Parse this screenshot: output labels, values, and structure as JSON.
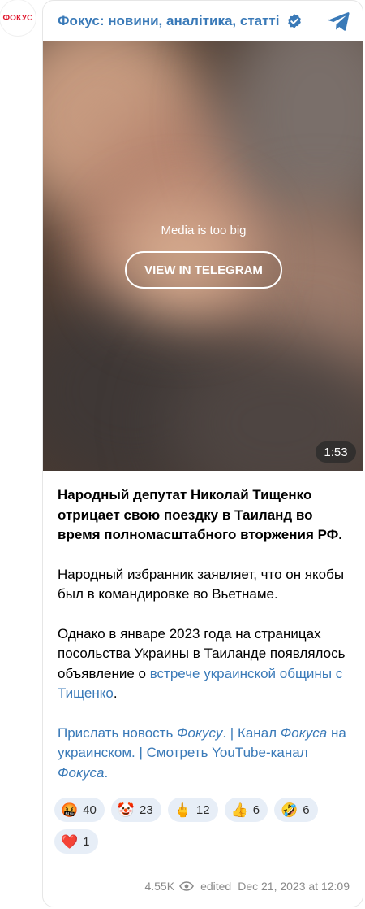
{
  "channel": {
    "avatar_text": "ФОКУС",
    "title": "Фокус: новини, аналітика, статті"
  },
  "media": {
    "message": "Media is too big",
    "button_label": "VIEW IN TELEGRAM",
    "duration": "1:53"
  },
  "post": {
    "lead": "Народный депутат Николай Тищенко отрицает свою поездку в Таиланд во время полномасштабного вторжения РФ.",
    "para2": "Народный избранник заявляет, что он якобы был в командировке во Вьетнаме.",
    "para3_text": "Однако в январе 2023 года на страницах посольства Украины в Таиланде появлялось объявление о ",
    "para3_link": "встрече украинской общины с Тищенко",
    "para3_end": ".",
    "footer_link1": "Прислать новость ",
    "footer_link1_em": "Фокусу",
    "footer_sep1": ". | ",
    "footer_link2a": "Канал ",
    "footer_link2_em": "Фокуса",
    "footer_link2b": " на украинском",
    "footer_sep2": ". | ",
    "footer_link3a": "Смотреть YouTube-канал ",
    "footer_link3_em": "Фокуса",
    "footer_end": "."
  },
  "reactions": [
    {
      "emoji": "🤬",
      "count": "40"
    },
    {
      "emoji": "🤡",
      "count": "23"
    },
    {
      "emoji": "🖕",
      "count": "12"
    },
    {
      "emoji": "👍",
      "count": "6"
    },
    {
      "emoji": "🤣",
      "count": "6"
    },
    {
      "emoji": "❤️",
      "count": "1"
    }
  ],
  "meta": {
    "views": "4.55K",
    "edited": "edited",
    "timestamp": "Dec 21, 2023 at 12:09"
  },
  "colors": {
    "link": "#3a7ab8",
    "reaction_bg": "#e7eef7",
    "brand_red": "#e0142b"
  }
}
